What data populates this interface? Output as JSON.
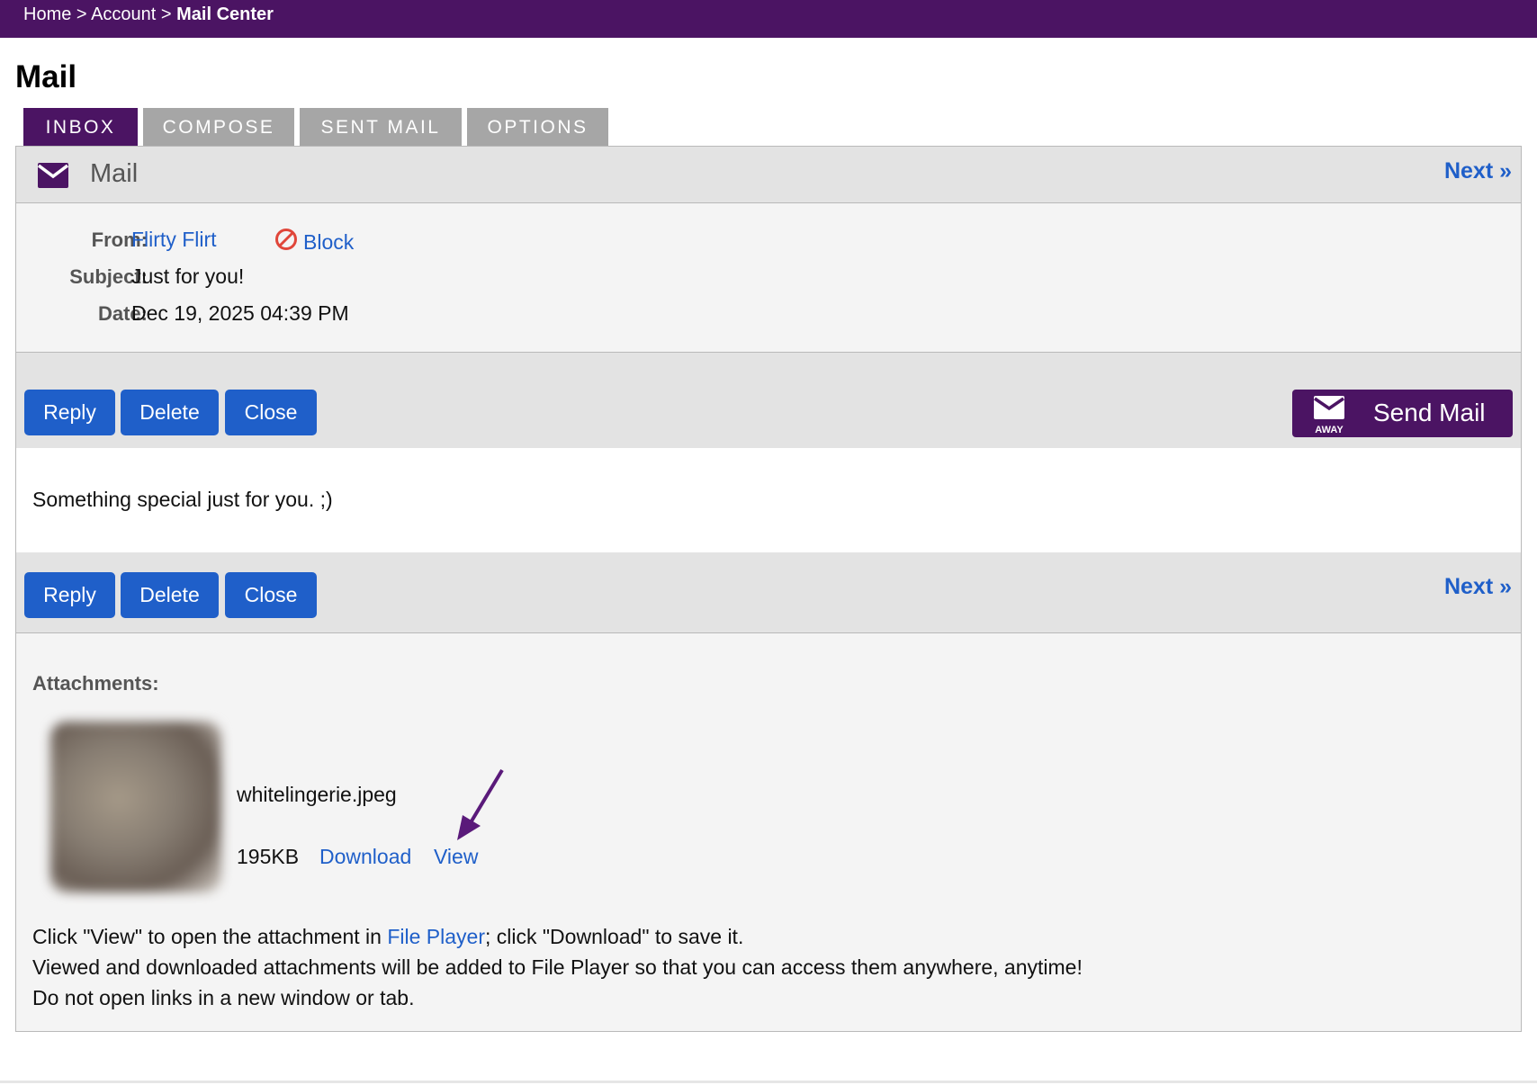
{
  "breadcrumb": {
    "home": "Home",
    "sep1": ">",
    "account": "Account",
    "sep2": ">",
    "current": "Mail Center"
  },
  "page_title": "Mail",
  "tabs": [
    {
      "label": "INBOX",
      "active": true
    },
    {
      "label": "COMPOSE",
      "active": false
    },
    {
      "label": "SENT MAIL",
      "active": false
    },
    {
      "label": "OPTIONS",
      "active": false
    }
  ],
  "mail_header": {
    "icon": "envelope-icon",
    "title": "Mail",
    "next_label": "Next »"
  },
  "message": {
    "from_label": "From:",
    "from_value": "Flirty Flirt",
    "block_label": "Block",
    "block_icon": "block-icon",
    "subject_label": "Subject:",
    "subject_value": "Just for you!",
    "date_label": "Date:",
    "date_value": "Dec 19, 2025 04:39 PM",
    "body": "Something special just for you. ;)"
  },
  "actions": {
    "reply_label": "Reply",
    "delete_label": "Delete",
    "close_label": "Close",
    "send_mail_label": "Send Mail",
    "send_mail_icon_text": "AWAY",
    "next_label": "Next »"
  },
  "attachments": {
    "label": "Attachments:",
    "file_name": "whitelingerie.jpeg",
    "file_size": "195KB",
    "download_label": "Download",
    "view_label": "View",
    "help_line1_a": "Click \"View\" to open the attachment in ",
    "help_line1_link": "File Player",
    "help_line1_b": "; click \"Download\" to save it.",
    "help_line2": "Viewed and downloaded attachments will be added to File Player so that you can access them anywhere, anytime!",
    "help_line3": "Do not open links in a new window or tab."
  },
  "colors": {
    "brand_purple": "#4b1463",
    "button_blue": "#1f5fc9",
    "tab_inactive": "#a6a6a6",
    "block_red": "#e0463a"
  }
}
